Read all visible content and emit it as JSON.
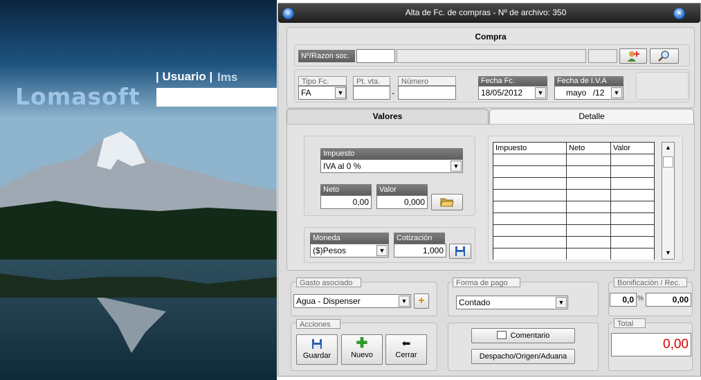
{
  "login": {
    "user_label": "| Usuario |",
    "user_value": "lms",
    "logo_text": "Lomasoft"
  },
  "window": {
    "title": "Alta de Fc. de compras - Nº de archivo: 350"
  },
  "compra": {
    "section_title": "Compra",
    "razon_label": "Nº/Razon soc.",
    "tipo_fc_label": "Tipo Fc.",
    "tipo_fc_value": "FA",
    "pt_vta_label": "Pt. vta.",
    "separator": "-",
    "numero_label": "Número",
    "fecha_fc_label": "Fecha Fc.",
    "fecha_fc_value": "18/05/2012",
    "fecha_iva_label": "Fecha de I.V.A",
    "fecha_iva_month": "mayo",
    "fecha_iva_year": "/12"
  },
  "tabs": [
    {
      "label": "Valores",
      "active": true
    },
    {
      "label": "Detalle",
      "active": false
    }
  ],
  "valores": {
    "impuesto_label": "Impuesto",
    "impuesto_value": "IVA al 0 %",
    "neto_label": "Neto",
    "neto_value": "0,00",
    "valor_label": "Valor",
    "valor_value": "0,000",
    "moneda_label": "Moneda",
    "moneda_value": "($)Pesos",
    "cotizacion_label": "Cotización",
    "cotizacion_value": "1,000"
  },
  "grid": {
    "columns": [
      "Impuesto",
      "Neto",
      "Valor"
    ],
    "row_count": 9
  },
  "gasto": {
    "label": "Gasto asociado",
    "value": "Agua - Dispenser"
  },
  "forma_pago": {
    "label": "Forma de pago",
    "value": "Contado"
  },
  "bonificacion": {
    "label": "Bonificación / Rec.",
    "percent_value": "0,0",
    "percent_sign": "%",
    "amount_value": "0,00"
  },
  "acciones": {
    "label": "Acciones",
    "guardar": "Guardar",
    "nuevo": "Nuevo",
    "cerrar": "Cerrar"
  },
  "extra_buttons": {
    "comentario": "Comentario",
    "despacho": "Despacho/Origen/Aduana"
  },
  "total": {
    "label": "Total",
    "value": "0,00"
  },
  "colors": {
    "total_red": "#d40000",
    "title_bar": "#2a2a2a",
    "accent_blue": "#2e72d0"
  }
}
